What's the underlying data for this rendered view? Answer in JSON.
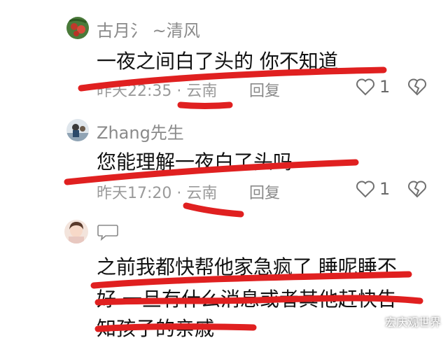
{
  "comments": [
    {
      "username": "古月氵 ~清风",
      "text": "一夜之间白了头的  你不知道",
      "meta": "昨天22:35 · 云南",
      "reply_label": "回复",
      "like_count": "1"
    },
    {
      "username": "Zhang先生",
      "text": "您能理解一夜白了头吗",
      "meta": "昨天17:20 · 云南",
      "reply_label": "回复",
      "like_count": "1"
    },
    {
      "username": "",
      "text_line1": "之前我都快帮他家急疯了  睡呢睡不",
      "text_line2": "好  一旦有什么消息或者其他赶快告",
      "text_line3": "知孩子的亲戚"
    }
  ],
  "watermark": "宏庆观世界",
  "colors": {
    "annotation_red": "#e02020",
    "meta_gray": "#9a9a9a",
    "text": "#111111"
  }
}
